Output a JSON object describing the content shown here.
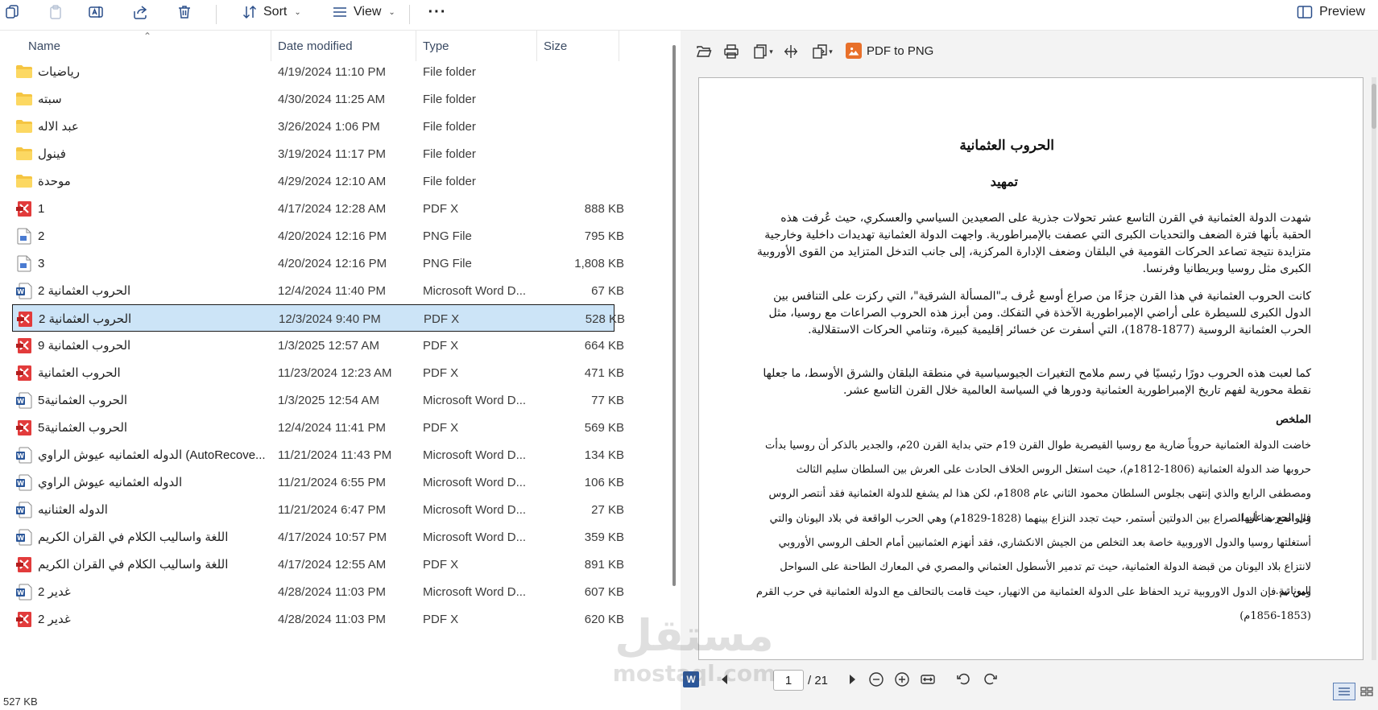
{
  "toolbar": {
    "sort_label": "Sort",
    "view_label": "View",
    "more_label": "···",
    "preview_label": "Preview"
  },
  "columns": {
    "name": "Name",
    "date": "Date modified",
    "type": "Type",
    "size": "Size"
  },
  "files": [
    {
      "name": "رياضيات",
      "date": "4/19/2024 11:10 PM",
      "type": "File folder",
      "size": "",
      "icon": "folder-icon"
    },
    {
      "name": "سبته",
      "date": "4/30/2024 11:25 AM",
      "type": "File folder",
      "size": "",
      "icon": "folder-icon"
    },
    {
      "name": "عبد الاله",
      "date": "3/26/2024 1:06 PM",
      "type": "File folder",
      "size": "",
      "icon": "folder-icon"
    },
    {
      "name": "فينول",
      "date": "3/19/2024 11:17 PM",
      "type": "File folder",
      "size": "",
      "icon": "folder-icon"
    },
    {
      "name": "موحدة",
      "date": "4/29/2024 12:10 AM",
      "type": "File folder",
      "size": "",
      "icon": "folder-icon"
    },
    {
      "name": "1",
      "date": "4/17/2024 12:28 AM",
      "type": "PDF X",
      "size": "888 KB",
      "icon": "pdf-icon"
    },
    {
      "name": "2",
      "date": "4/20/2024 12:16 PM",
      "type": "PNG File",
      "size": "795 KB",
      "icon": "png-icon"
    },
    {
      "name": "3",
      "date": "4/20/2024 12:16 PM",
      "type": "PNG File",
      "size": "1,808 KB",
      "icon": "png-icon"
    },
    {
      "name": "الحروب العثمانية 2",
      "date": "12/4/2024 11:40 PM",
      "type": "Microsoft Word D...",
      "size": "67 KB",
      "icon": "word-icon"
    },
    {
      "name": "الحروب العثمانية 2",
      "date": "12/3/2024 9:40 PM",
      "type": "PDF X",
      "size": "528 KB",
      "icon": "pdf-icon",
      "selected": true
    },
    {
      "name": "الحروب العثمانية 9",
      "date": "1/3/2025 12:57 AM",
      "type": "PDF X",
      "size": "664 KB",
      "icon": "pdf-icon"
    },
    {
      "name": "الحروب العثمانية",
      "date": "11/23/2024 12:23 AM",
      "type": "PDF X",
      "size": "471 KB",
      "icon": "pdf-icon"
    },
    {
      "name": "الحروب العثمانية5",
      "date": "1/3/2025 12:54 AM",
      "type": "Microsoft Word D...",
      "size": "77 KB",
      "icon": "word-icon"
    },
    {
      "name": "الحروب العثمانية5",
      "date": "12/4/2024 11:41 PM",
      "type": "PDF X",
      "size": "569 KB",
      "icon": "pdf-icon"
    },
    {
      "name": "الدوله العثمانيه عيوش الراوي (AutoRecove...",
      "date": "11/21/2024 11:43 PM",
      "type": "Microsoft Word D...",
      "size": "134 KB",
      "icon": "word-icon"
    },
    {
      "name": "الدوله العثمانيه عيوش الراوي",
      "date": "11/21/2024 6:55 PM",
      "type": "Microsoft Word D...",
      "size": "106 KB",
      "icon": "word-icon"
    },
    {
      "name": "الدوله العثنانيه",
      "date": "11/21/2024 6:47 PM",
      "type": "Microsoft Word D...",
      "size": "27 KB",
      "icon": "word-icon"
    },
    {
      "name": "اللغة واساليب الكلام في القران الكريم",
      "date": "4/17/2024 10:57 PM",
      "type": "Microsoft Word D...",
      "size": "359 KB",
      "icon": "word-icon"
    },
    {
      "name": "اللغة واساليب الكلام في القران الكريم",
      "date": "4/17/2024 12:55 AM",
      "type": "PDF X",
      "size": "891 KB",
      "icon": "pdf-icon"
    },
    {
      "name": "غدير 2",
      "date": "4/28/2024 11:03 PM",
      "type": "Microsoft Word D...",
      "size": "607 KB",
      "icon": "word-icon"
    },
    {
      "name": "غدير 2",
      "date": "4/28/2024 11:03 PM",
      "type": "PDF X",
      "size": "620 KB",
      "icon": "pdf-icon"
    }
  ],
  "status_text": "527 KB",
  "preview": {
    "pdf_to_png_label": "PDF to PNG",
    "current_page": "1",
    "total_pages": "/ 21",
    "doc_title": "الحروب العثمانية",
    "doc_subtitle": "تمهيد",
    "paragraphs": [
      "شهدت الدولة العثمانية في القرن التاسع عشر تحولات جذرية على الصعيدين السياسي والعسكري، حيث عُرفت هذه الحقبة بأنها فترة الضعف والتحديات الكبرى التي عصفت بالإمبراطورية. واجهت الدولة العثمانية تهديدات داخلية وخارجية متزايدة نتيجة تصاعد الحركات القومية في البلقان وضعف الإدارة المركزية، إلى جانب التدخل المتزايد من القوى الأوروبية الكبرى مثل روسيا وبريطانيا وفرنسا.",
      "كانت الحروب العثمانية في هذا القرن جزءًا من صراع أوسع عُرف بـ\"المسألة الشرقية\"، التي ركزت على التنافس بين الدول الكبرى للسيطرة على أراضي الإمبراطورية الآخذة في التفكك. ومن أبرز هذه الحروب الصراعات مع روسيا، مثل الحرب العثمانية الروسية (1877-1878)، التي أسفرت عن خسائر إقليمية كبيرة، وتنامي الحركات الاستقلالية.",
      "كما لعبت هذه الحروب دورًا رئيسيًا في رسم ملامح التغيرات الجيوسياسية في منطقة البلقان والشرق الأوسط، ما جعلها نقطة محورية لفهم تاريخ الإمبراطورية العثمانية ودورها في السياسة العالمية خلال القرن التاسع عشر."
    ],
    "summary_heading": "الملخص",
    "summary_paragraphs": [
      "خاضت الدولة العثمانية حروباً ضارية مع روسيا القيصرية طوال القرن 19م حتي بداية القرن 20م، والجدير بالذكر أن روسيا بدأت حروبها ضد الدولة العثمانية (1806-1812م)، حيث استغل الروس الخلاف الحادث على العرش بين السلطان سليم الثالث ومصطفى الرابع والذي إنتهى بجلوس السلطان محمود الثاني عام 1808م، لكن هذا لم يشفع للدولة العثمانية فقد أنتصر الروس في الحرب عليها.",
      "والواضح هنا أن الصراع بين الدولتين أستمر، حيث تجدد النزاع بينهما (1828-1829م) وهي الحرب الواقعة في بلاد اليونان والتي أستغلتها روسيا والدول الاوروبية خاصة بعد التخلص من الجيش الانكشاري، فقد أنهزم العثمانيين أمام الحلف الروسي الأوروبي لانتزاع بلاد اليونان من قبضة الدولة العثمانية، حيث تم تدمير الأسطول العثماني والمصري في المعارك الطاحنة على السواحل اليونانية.",
      "ومن ثم فإن الدول الاوروبية تريد الحفاظ على الدولة العثمانية من الانهيار، حيث قامت بالتحالف مع الدولة العثمانية في حرب القرم (1853-1856م)"
    ]
  },
  "watermark": {
    "arabic": "مستقل",
    "latin": "mostaql.com"
  }
}
